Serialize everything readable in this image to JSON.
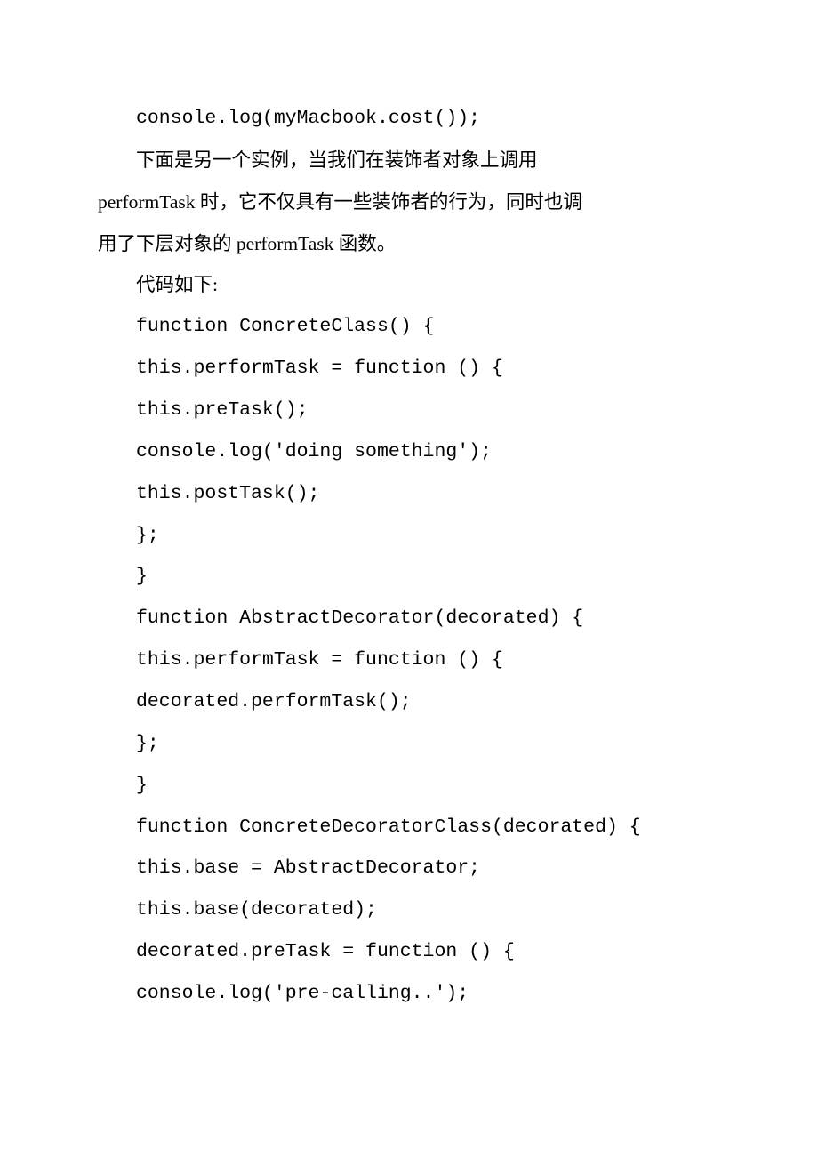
{
  "lines": [
    "console.log(myMacbook.cost());",
    "下面是另一个实例，当我们在装饰者对象上调用",
    "performTask 时，它不仅具有一些装饰者的行为，同时也调",
    "用了下层对象的 performTask 函数。",
    "代码如下:",
    "function ConcreteClass() {",
    "this.performTask = function () {",
    "this.preTask();",
    "console.log('doing something');",
    "this.postTask();",
    "};",
    "}",
    "function AbstractDecorator(decorated) {",
    "this.performTask = function () {",
    "decorated.performTask();",
    "};",
    "}",
    "function ConcreteDecoratorClass(decorated) {",
    "this.base = AbstractDecorator;",
    "this.base(decorated);",
    "decorated.preTask = function () {",
    "console.log('pre-calling..');"
  ],
  "indentFlags": [
    true,
    true,
    false,
    false,
    true,
    true,
    true,
    true,
    true,
    true,
    true,
    true,
    true,
    true,
    true,
    true,
    true,
    true,
    true,
    true,
    true,
    true
  ]
}
